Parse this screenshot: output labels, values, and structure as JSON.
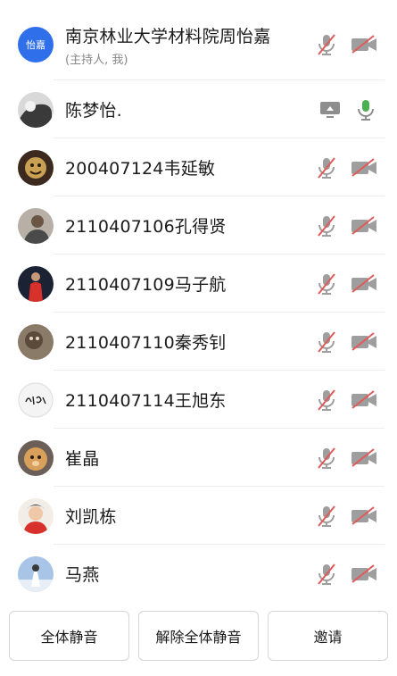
{
  "participants": [
    {
      "name": "南京林业大学材料院周怡嘉",
      "role": "(主持人, 我)",
      "avatar_text": "怡嘉",
      "mic": "muted",
      "camera": "off"
    },
    {
      "name": "陈梦怡.",
      "mic": "active",
      "camera": "sharing"
    },
    {
      "name": "200407124韦延敏",
      "mic": "muted",
      "camera": "off"
    },
    {
      "name": "2110407106孔得贤",
      "mic": "muted",
      "camera": "off"
    },
    {
      "name": "2110407109马子航",
      "mic": "muted",
      "camera": "off"
    },
    {
      "name": "2110407110秦秀钊",
      "mic": "muted",
      "camera": "off"
    },
    {
      "name": "2110407114王旭东",
      "mic": "muted",
      "camera": "off"
    },
    {
      "name": "崔晶",
      "mic": "muted",
      "camera": "off"
    },
    {
      "name": "刘凯栋",
      "mic": "muted",
      "camera": "off"
    },
    {
      "name": "马燕",
      "mic": "muted",
      "camera": "off"
    }
  ],
  "footer": {
    "mute_all": "全体静音",
    "unmute_all": "解除全体静音",
    "invite": "邀请"
  },
  "colors": {
    "host_avatar": "#2f6fe9",
    "mic_active": "#4caf50",
    "muted_slash": "#e05a5a",
    "icon_gray": "#9e9e9e"
  }
}
